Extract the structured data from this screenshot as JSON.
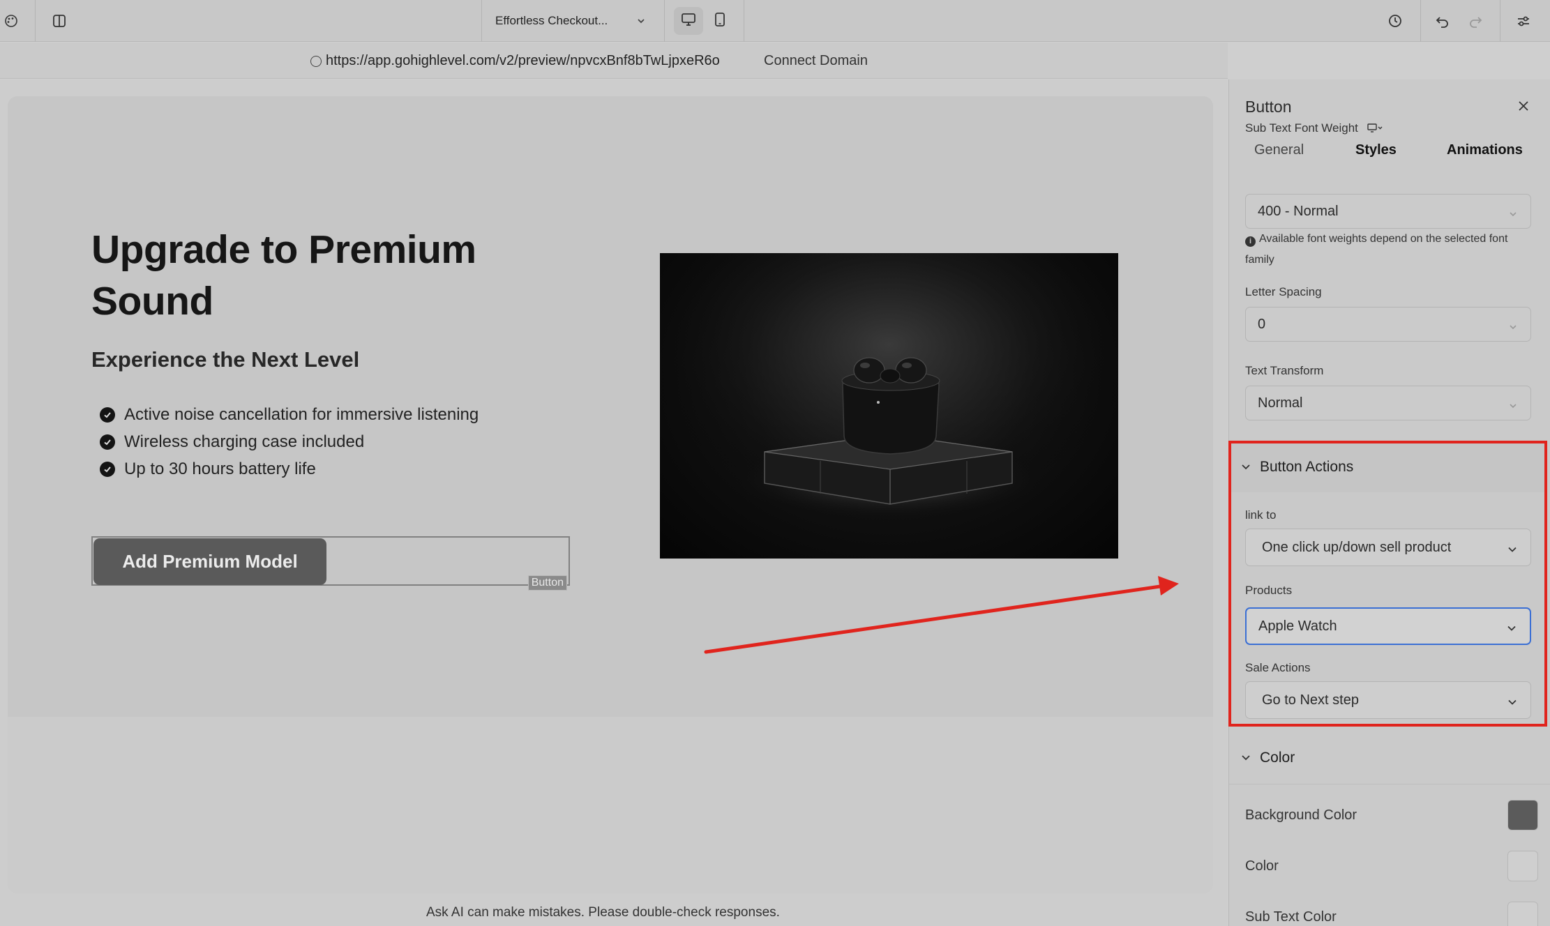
{
  "toolbar": {
    "page_name": "Effortless Checkout...",
    "icons": [
      "palette-icon",
      "sidebar-toggle-icon",
      "chevron-down-icon",
      "desktop-icon",
      "mobile-icon",
      "history-icon",
      "undo-icon",
      "redo-icon",
      "settings-sliders-icon"
    ]
  },
  "urlbar": {
    "url": "https://app.gohighlevel.com/v2/preview/npvcxBnf8bTwLjpxeR6o",
    "connect_label": "Connect Domain"
  },
  "canvas": {
    "headline": "Upgrade to Premium Sound",
    "subhead": "Experience the Next Level",
    "features": [
      "Active noise cancellation for immersive listening",
      "Wireless charging case included",
      "Up to 30 hours battery life"
    ],
    "cta_label": "Add Premium Model",
    "element_tag": "Button",
    "ai_note": "Ask AI can make mistakes. Please double-check responses."
  },
  "panel": {
    "title": "Button",
    "tabs": [
      "General",
      "Styles",
      "Animations"
    ],
    "active_tab": "Styles",
    "sub_text_weight_label": "Sub Text Font Weight",
    "sub_text_weight_value": "400 - Normal",
    "weight_hint": "Available font weights depend on the selected font family",
    "letter_spacing_label": "Letter Spacing",
    "letter_spacing_value": "0",
    "text_transform_label": "Text Transform",
    "text_transform_value": "Normal",
    "button_actions": {
      "title": "Button Actions",
      "link_to_label": "link to",
      "link_to_value": "One click up/down sell product",
      "products_label": "Products",
      "products_value": "Apple Watch",
      "sale_actions_label": "Sale Actions",
      "sale_actions_value": "Go to Next step"
    },
    "color_section": {
      "title": "Color",
      "rows": [
        {
          "label": "Background Color",
          "swatch": "#5b5b5b"
        },
        {
          "label": "Color",
          "swatch": "#cfcfcf"
        },
        {
          "label": "Sub Text Color",
          "swatch": "#cfcfcf"
        }
      ]
    }
  },
  "colors": {
    "highlight": "#e0241d",
    "focus": "#3b6fd4"
  }
}
